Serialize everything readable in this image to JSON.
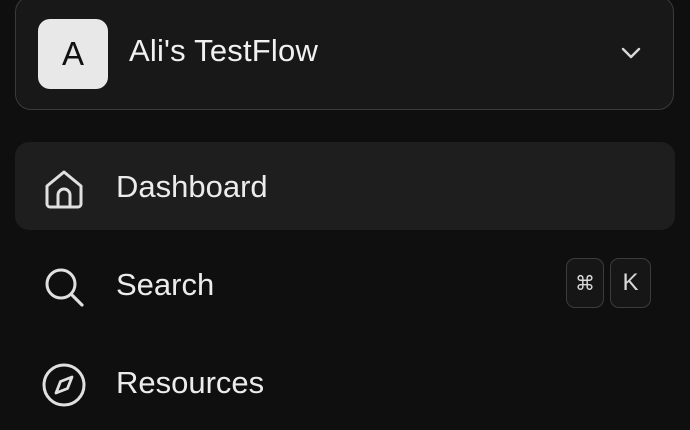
{
  "workspace": {
    "avatar_letter": "A",
    "name": "Ali's TestFlow",
    "chevron_icon": "chevron-down-icon"
  },
  "nav": {
    "items": [
      {
        "label": "Dashboard",
        "icon": "home-icon",
        "active": true
      },
      {
        "label": "Search",
        "icon": "search-icon",
        "active": false,
        "shortcut": [
          "⌘",
          "K"
        ]
      },
      {
        "label": "Resources",
        "icon": "compass-icon",
        "active": false
      }
    ]
  },
  "colors": {
    "background": "#0f0f0f",
    "active_item": "#1e1e1e",
    "border": "#3a3a3a",
    "text": "#ececec",
    "avatar_bg": "#e8e8e8"
  }
}
